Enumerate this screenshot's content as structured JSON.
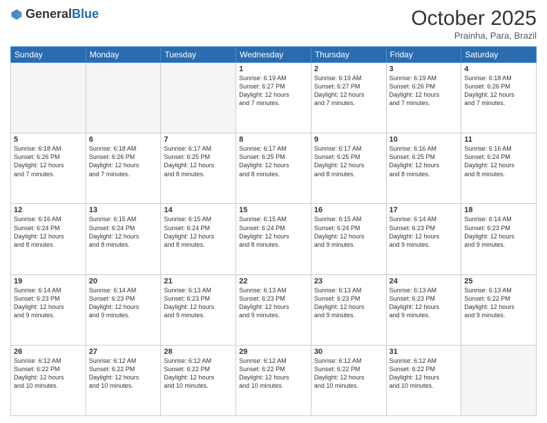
{
  "header": {
    "logo_general": "General",
    "logo_blue": "Blue",
    "month_title": "October 2025",
    "subtitle": "Prainha, Para, Brazil"
  },
  "weekdays": [
    "Sunday",
    "Monday",
    "Tuesday",
    "Wednesday",
    "Thursday",
    "Friday",
    "Saturday"
  ],
  "weeks": [
    [
      {
        "day": "",
        "info": ""
      },
      {
        "day": "",
        "info": ""
      },
      {
        "day": "",
        "info": ""
      },
      {
        "day": "1",
        "info": "Sunrise: 6:19 AM\nSunset: 6:27 PM\nDaylight: 12 hours\nand 7 minutes."
      },
      {
        "day": "2",
        "info": "Sunrise: 6:19 AM\nSunset: 6:27 PM\nDaylight: 12 hours\nand 7 minutes."
      },
      {
        "day": "3",
        "info": "Sunrise: 6:19 AM\nSunset: 6:26 PM\nDaylight: 12 hours\nand 7 minutes."
      },
      {
        "day": "4",
        "info": "Sunrise: 6:18 AM\nSunset: 6:26 PM\nDaylight: 12 hours\nand 7 minutes."
      }
    ],
    [
      {
        "day": "5",
        "info": "Sunrise: 6:18 AM\nSunset: 6:26 PM\nDaylight: 12 hours\nand 7 minutes."
      },
      {
        "day": "6",
        "info": "Sunrise: 6:18 AM\nSunset: 6:26 PM\nDaylight: 12 hours\nand 7 minutes."
      },
      {
        "day": "7",
        "info": "Sunrise: 6:17 AM\nSunset: 6:25 PM\nDaylight: 12 hours\nand 8 minutes."
      },
      {
        "day": "8",
        "info": "Sunrise: 6:17 AM\nSunset: 6:25 PM\nDaylight: 12 hours\nand 8 minutes."
      },
      {
        "day": "9",
        "info": "Sunrise: 6:17 AM\nSunset: 6:25 PM\nDaylight: 12 hours\nand 8 minutes."
      },
      {
        "day": "10",
        "info": "Sunrise: 6:16 AM\nSunset: 6:25 PM\nDaylight: 12 hours\nand 8 minutes."
      },
      {
        "day": "11",
        "info": "Sunrise: 6:16 AM\nSunset: 6:24 PM\nDaylight: 12 hours\nand 8 minutes."
      }
    ],
    [
      {
        "day": "12",
        "info": "Sunrise: 6:16 AM\nSunset: 6:24 PM\nDaylight: 12 hours\nand 8 minutes."
      },
      {
        "day": "13",
        "info": "Sunrise: 6:15 AM\nSunset: 6:24 PM\nDaylight: 12 hours\nand 8 minutes."
      },
      {
        "day": "14",
        "info": "Sunrise: 6:15 AM\nSunset: 6:24 PM\nDaylight: 12 hours\nand 8 minutes."
      },
      {
        "day": "15",
        "info": "Sunrise: 6:15 AM\nSunset: 6:24 PM\nDaylight: 12 hours\nand 8 minutes."
      },
      {
        "day": "16",
        "info": "Sunrise: 6:15 AM\nSunset: 6:24 PM\nDaylight: 12 hours\nand 9 minutes."
      },
      {
        "day": "17",
        "info": "Sunrise: 6:14 AM\nSunset: 6:23 PM\nDaylight: 12 hours\nand 9 minutes."
      },
      {
        "day": "18",
        "info": "Sunrise: 6:14 AM\nSunset: 6:23 PM\nDaylight: 12 hours\nand 9 minutes."
      }
    ],
    [
      {
        "day": "19",
        "info": "Sunrise: 6:14 AM\nSunset: 6:23 PM\nDaylight: 12 hours\nand 9 minutes."
      },
      {
        "day": "20",
        "info": "Sunrise: 6:14 AM\nSunset: 6:23 PM\nDaylight: 12 hours\nand 9 minutes."
      },
      {
        "day": "21",
        "info": "Sunrise: 6:13 AM\nSunset: 6:23 PM\nDaylight: 12 hours\nand 9 minutes."
      },
      {
        "day": "22",
        "info": "Sunrise: 6:13 AM\nSunset: 6:23 PM\nDaylight: 12 hours\nand 9 minutes."
      },
      {
        "day": "23",
        "info": "Sunrise: 6:13 AM\nSunset: 6:23 PM\nDaylight: 12 hours\nand 9 minutes."
      },
      {
        "day": "24",
        "info": "Sunrise: 6:13 AM\nSunset: 6:23 PM\nDaylight: 12 hours\nand 9 minutes."
      },
      {
        "day": "25",
        "info": "Sunrise: 6:13 AM\nSunset: 6:22 PM\nDaylight: 12 hours\nand 9 minutes."
      }
    ],
    [
      {
        "day": "26",
        "info": "Sunrise: 6:12 AM\nSunset: 6:22 PM\nDaylight: 12 hours\nand 10 minutes."
      },
      {
        "day": "27",
        "info": "Sunrise: 6:12 AM\nSunset: 6:22 PM\nDaylight: 12 hours\nand 10 minutes."
      },
      {
        "day": "28",
        "info": "Sunrise: 6:12 AM\nSunset: 6:22 PM\nDaylight: 12 hours\nand 10 minutes."
      },
      {
        "day": "29",
        "info": "Sunrise: 6:12 AM\nSunset: 6:22 PM\nDaylight: 12 hours\nand 10 minutes."
      },
      {
        "day": "30",
        "info": "Sunrise: 6:12 AM\nSunset: 6:22 PM\nDaylight: 12 hours\nand 10 minutes."
      },
      {
        "day": "31",
        "info": "Sunrise: 6:12 AM\nSunset: 6:22 PM\nDaylight: 12 hours\nand 10 minutes."
      },
      {
        "day": "",
        "info": ""
      }
    ]
  ]
}
